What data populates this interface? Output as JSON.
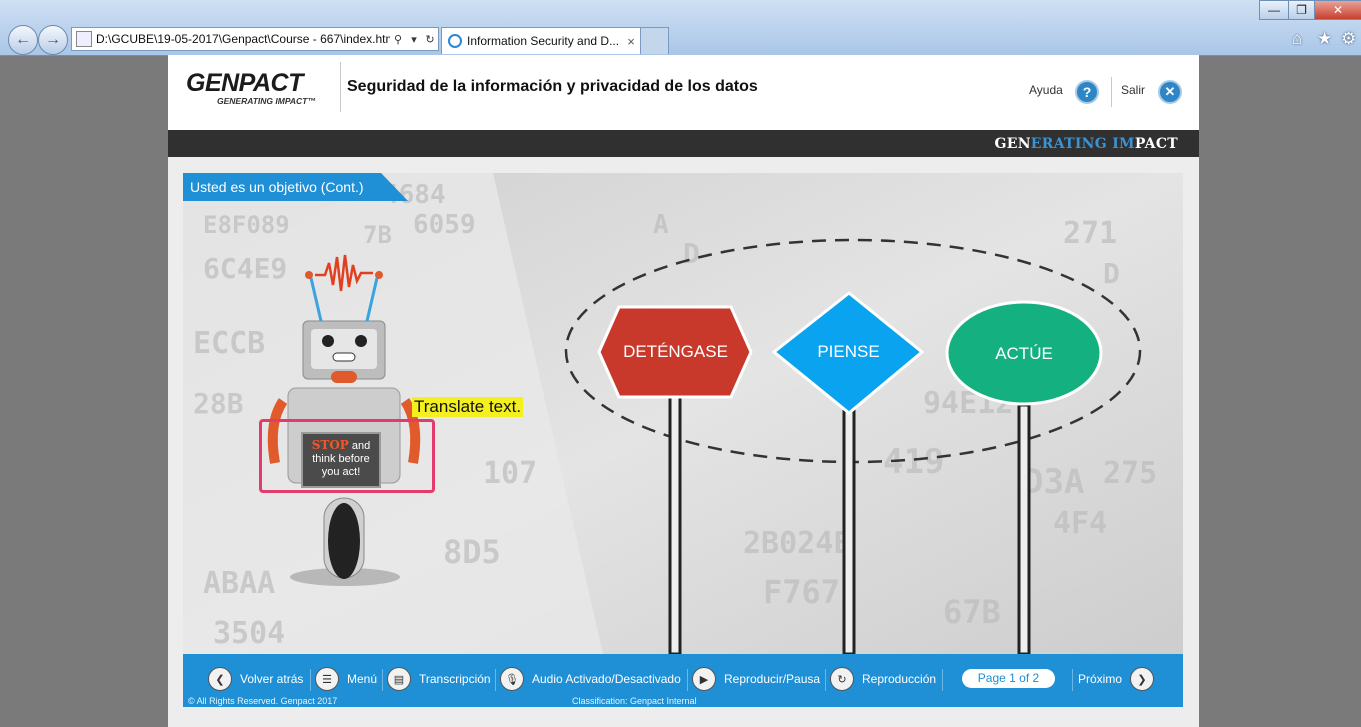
{
  "browser": {
    "address": "D:\\GCUBE\\19-05-2017\\Genpact\\Course - 667\\index.htm",
    "tab_title": "Information Security and D...",
    "tab_close": "×"
  },
  "header": {
    "logo_main": "GENPACT",
    "logo_sub": "GENERATING IMPACT™",
    "course_title": "Seguridad de la información y privacidad de los datos",
    "help_label": "Ayuda",
    "exit_label": "Salir",
    "tagline_parts": [
      "GEN",
      "ERATING ",
      "IM",
      "PACT"
    ]
  },
  "slide": {
    "title": "Usted es un objetivo (Cont.)",
    "signs": [
      "DETÉNGASE",
      "PIENSE",
      "ACTÚE"
    ],
    "callout": "Translate text.",
    "card_stop": "STOP",
    "card_rest_1": " and",
    "card_rest_2": "think before",
    "card_rest_3": "you act!"
  },
  "footer": {
    "back": "Volver atrás",
    "menu": "Menú",
    "transcript": "Transcripción",
    "audio": "Audio Activado/Desactivado",
    "playpause": "Reproducir/Pausa",
    "replay": "Reproducción",
    "page_indicator": "Page 1 of 2",
    "next": "Próximo",
    "copyright": "© All Rights Reserved. Genpact 2017",
    "classification": "Classification: Genpact Internal"
  },
  "colors": {
    "accent_blue": "#1f8fd6",
    "stop_red": "#c8392b",
    "think_blue": "#0aa3ef",
    "act_green": "#14b080",
    "callout_yellow": "#f4f020"
  }
}
